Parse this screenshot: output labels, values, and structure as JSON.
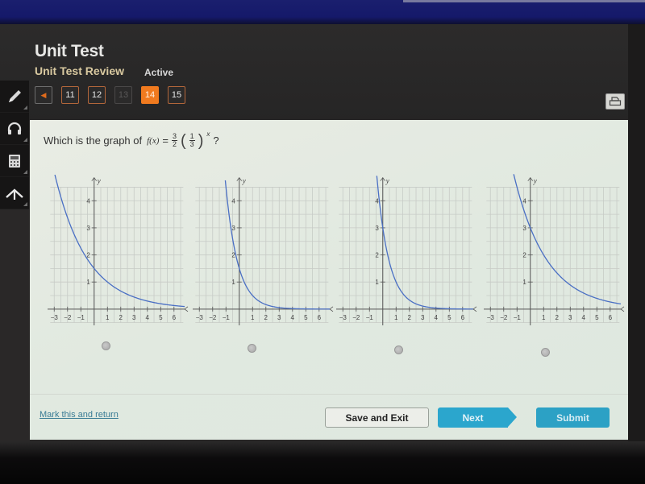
{
  "header": {
    "title": "Unit Test",
    "subtitle": "Unit Test Review",
    "status": "Active"
  },
  "question_nav": {
    "prev_icon": "◀",
    "items": [
      {
        "label": "11",
        "state": "visited"
      },
      {
        "label": "12",
        "state": "visited"
      },
      {
        "label": "13",
        "state": "disabled"
      },
      {
        "label": "14",
        "state": "current"
      },
      {
        "label": "15",
        "state": "visited"
      }
    ]
  },
  "tools": [
    "pencil-icon",
    "headphones-icon",
    "calculator-icon",
    "reference-icon"
  ],
  "question": {
    "text": "Which is the graph of",
    "fn": "f(x)",
    "equals": "=",
    "coef_num": "3",
    "coef_den": "2",
    "base_num": "1",
    "base_den": "3",
    "exponent": "x",
    "end": "?"
  },
  "colors": {
    "accent": "#f07a1f",
    "curve": "#4a6fc4",
    "primary_button": "#2ba6cd",
    "link": "#3a7c95"
  },
  "chart_data": [
    {
      "type": "line",
      "name": "option-a",
      "formula": "1.5*(2/3)^x",
      "a": 1.5,
      "b": 0.6667,
      "xlabel": "",
      "ylabel": "y",
      "xlim": [
        -3,
        6
      ],
      "ylim": [
        0,
        4
      ],
      "xticks": [
        "-3",
        "-2",
        "-1",
        "1",
        "2",
        "3",
        "4",
        "5",
        "6"
      ],
      "yticks": [
        "1",
        "2",
        "3",
        "4"
      ],
      "grid": true
    },
    {
      "type": "line",
      "name": "option-b",
      "formula": "1.5*(1/3)^x",
      "a": 1.5,
      "b": 0.3333,
      "xlabel": "",
      "ylabel": "y",
      "xlim": [
        -3,
        6
      ],
      "ylim": [
        0,
        4
      ],
      "xticks": [
        "-3",
        "-2",
        "-1",
        "1",
        "2",
        "3",
        "4",
        "5",
        "6"
      ],
      "yticks": [
        "1",
        "2",
        "3",
        "4"
      ],
      "grid": true
    },
    {
      "type": "line",
      "name": "option-c",
      "formula": "3*(1/3)^x",
      "a": 3,
      "b": 0.3333,
      "xlabel": "",
      "ylabel": "y",
      "xlim": [
        -3,
        6
      ],
      "ylim": [
        0,
        4
      ],
      "xticks": [
        "-3",
        "-2",
        "-1",
        "1",
        "2",
        "3",
        "4",
        "5",
        "6"
      ],
      "yticks": [
        "1",
        "2",
        "3",
        "4"
      ],
      "grid": true
    },
    {
      "type": "line",
      "name": "option-d",
      "formula": "3*(2/3)^x",
      "a": 3,
      "b": 0.6667,
      "xlabel": "",
      "ylabel": "y",
      "xlim": [
        -3,
        6
      ],
      "ylim": [
        0,
        4
      ],
      "xticks": [
        "-3",
        "-2",
        "-1",
        "1",
        "2",
        "3",
        "4",
        "5",
        "6"
      ],
      "yticks": [
        "1",
        "2",
        "3",
        "4"
      ],
      "grid": true
    }
  ],
  "footer": {
    "mark_link": "Mark this and return",
    "save_exit": "Save and Exit",
    "next": "Next",
    "submit": "Submit"
  }
}
